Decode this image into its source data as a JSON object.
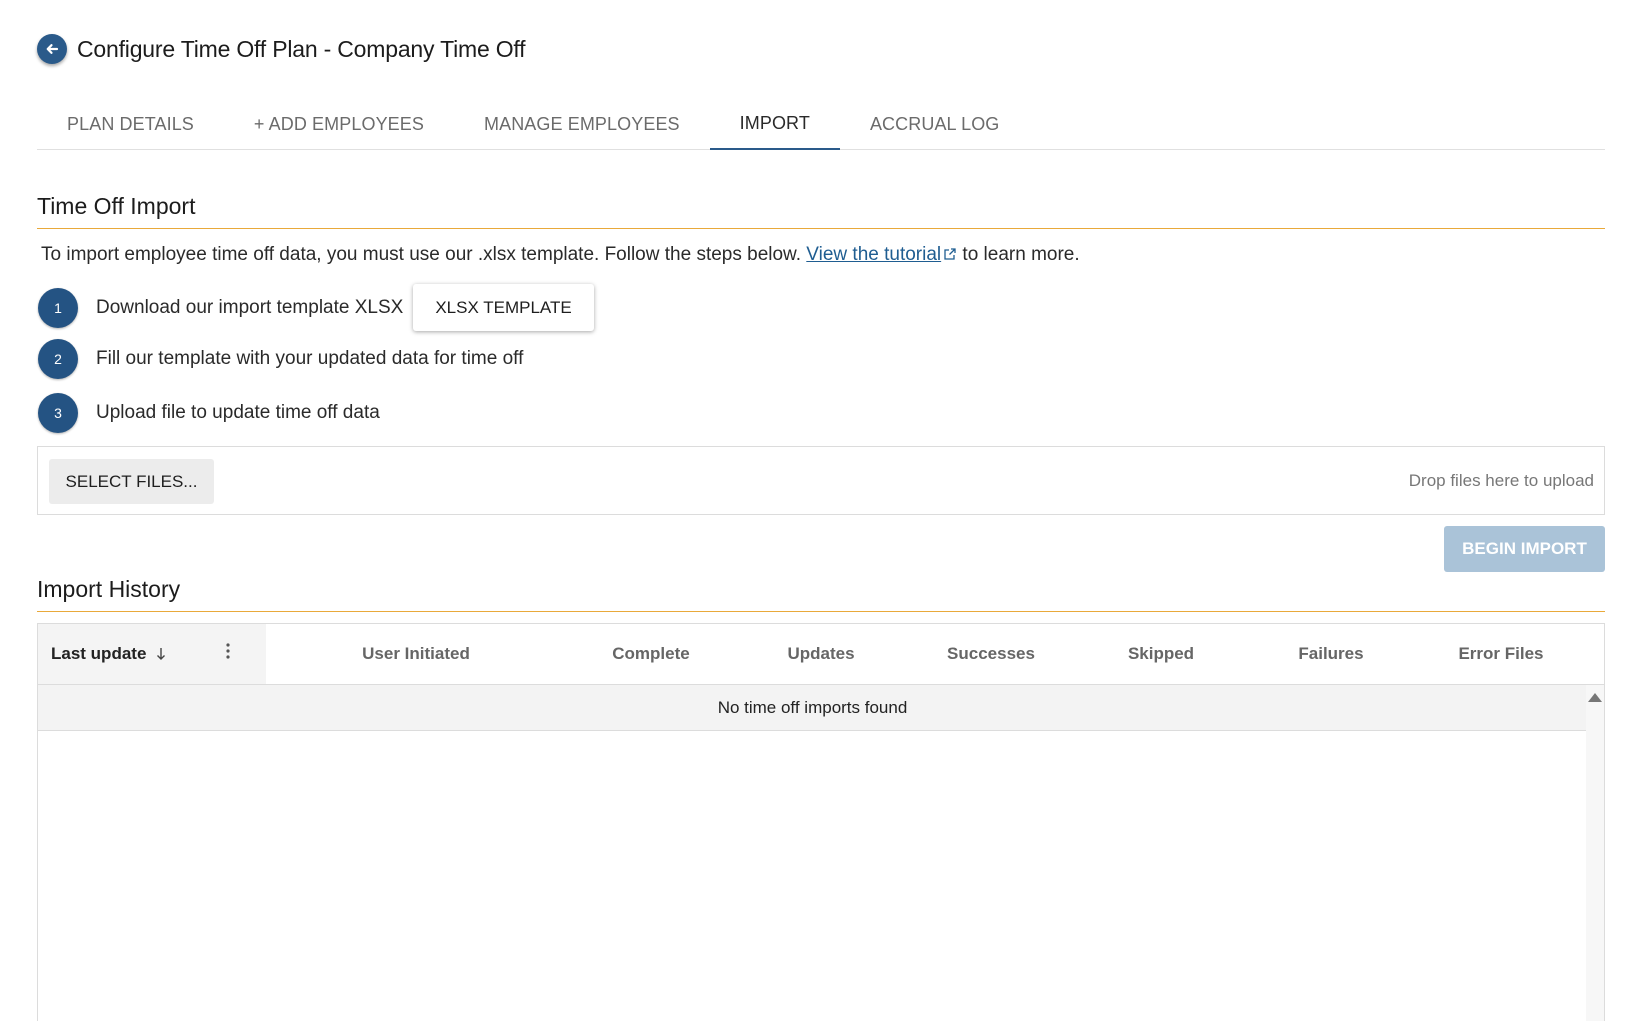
{
  "header": {
    "title": "Configure Time Off Plan - Company Time Off",
    "back_icon": "arrow-left-icon"
  },
  "tabs": [
    {
      "label": "PLAN DETAILS",
      "active": false
    },
    {
      "label": "+ ADD EMPLOYEES",
      "active": false
    },
    {
      "label": "MANAGE EMPLOYEES",
      "active": false
    },
    {
      "label": "IMPORT",
      "active": true
    },
    {
      "label": "ACCRUAL LOG",
      "active": false
    }
  ],
  "import": {
    "heading": "Time Off Import",
    "intro_before": "To import employee time off data, you must use our .xlsx template. Follow the steps below. ",
    "intro_link": "View the tutorial",
    "intro_after": " to learn more.",
    "steps": [
      {
        "num": "1",
        "text": "Download our import template XLSX",
        "button": "XLSX TEMPLATE"
      },
      {
        "num": "2",
        "text": "Fill our template with your updated data for time off"
      },
      {
        "num": "3",
        "text": "Upload file to update time off data"
      }
    ],
    "select_files": "SELECT FILES...",
    "drop_hint": "Drop files here to upload",
    "begin_import": "BEGIN IMPORT"
  },
  "history": {
    "heading": "Import History",
    "columns": [
      "Last update",
      "User Initiated",
      "Complete",
      "Updates",
      "Successes",
      "Skipped",
      "Failures",
      "Error Files"
    ],
    "empty_message": "No time off imports found"
  },
  "colors": {
    "primary": "#245383",
    "accent_underline": "#e9a93a",
    "begin_disabled": "#aac3d8"
  }
}
